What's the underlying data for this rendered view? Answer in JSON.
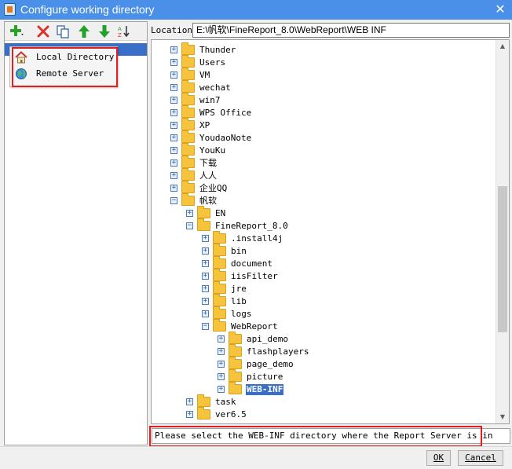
{
  "window": {
    "title": "Configure working directory",
    "close_glyph": "✕"
  },
  "toolbar": {
    "buttons": [
      {
        "name": "add-dropdown-button",
        "icon": "plus-icon",
        "color": "#2aa12a"
      },
      {
        "name": "delete-button",
        "icon": "red-x-icon",
        "color": "#d9342b"
      },
      {
        "name": "copy-button",
        "icon": "copy-icon",
        "color": "#2b5d9a"
      },
      {
        "name": "move-up-button",
        "icon": "green-up-arrow-icon",
        "color": "#22a02a"
      },
      {
        "name": "move-down-button",
        "icon": "green-down-arrow-icon",
        "color": "#22a02a"
      },
      {
        "name": "sort-button",
        "icon": "sort-az-icon",
        "color": "#2aa12a"
      }
    ]
  },
  "add_menu": {
    "items": [
      {
        "label": "Local Directory",
        "icon": "home-icon"
      },
      {
        "label": "Remote Server",
        "icon": "globe-icon"
      }
    ]
  },
  "location": {
    "label": "Location:",
    "value": "E:\\帆软\\FineReport_8.0\\WebReport\\WEB INF"
  },
  "tree": {
    "rows": [
      {
        "label": "Thunder",
        "expanded": false
      },
      {
        "label": "Users",
        "expanded": false
      },
      {
        "label": "VM",
        "expanded": false
      },
      {
        "label": "wechat",
        "expanded": false
      },
      {
        "label": "win7",
        "expanded": false
      },
      {
        "label": "WPS Office",
        "expanded": false
      },
      {
        "label": "XP",
        "expanded": false
      },
      {
        "label": "YoudaoNote",
        "expanded": false
      },
      {
        "label": " YouKu",
        "expanded": false
      },
      {
        "label": "下载",
        "expanded": false
      },
      {
        "label": "人人",
        "expanded": false
      },
      {
        "label": "企业QQ",
        "expanded": false
      },
      {
        "label": "帆软",
        "expanded": true
      },
      {
        "label": "EN",
        "expanded": false
      },
      {
        "label": "FineReport_8.0",
        "expanded": true
      },
      {
        "label": ".install4j",
        "expanded": false
      },
      {
        "label": "bin",
        "expanded": false
      },
      {
        "label": "document",
        "expanded": false
      },
      {
        "label": "iisFilter",
        "expanded": false
      },
      {
        "label": "jre",
        "expanded": false
      },
      {
        "label": "lib",
        "expanded": false
      },
      {
        "label": "logs",
        "expanded": false
      },
      {
        "label": "WebReport",
        "expanded": true
      },
      {
        "label": "api_demo",
        "expanded": false
      },
      {
        "label": "flashplayers",
        "expanded": false
      },
      {
        "label": "page_demo",
        "expanded": false
      },
      {
        "label": "picture",
        "expanded": false
      },
      {
        "label": "WEB-INF",
        "expanded": false,
        "selected": true
      },
      {
        "label": "task",
        "expanded": false
      },
      {
        "label": "ver6.5",
        "expanded": false
      }
    ]
  },
  "status": {
    "text": "Please select the WEB-INF directory where the Report Server is in"
  },
  "buttons": {
    "ok": "OK",
    "cancel": "Cancel"
  },
  "colors": {
    "title_bar": "#4a90e8",
    "selection": "#3a6fc9",
    "highlight_box": "#e02020",
    "folder": "#f6c33c"
  }
}
